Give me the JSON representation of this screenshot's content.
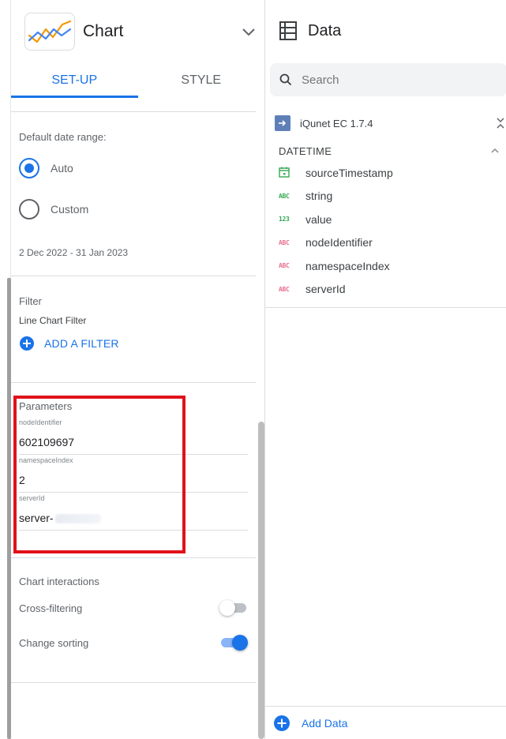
{
  "chart_panel": {
    "title": "Chart",
    "tabs": [
      {
        "label": "SET-UP",
        "active": true
      },
      {
        "label": "STYLE",
        "active": false
      }
    ]
  },
  "date_range": {
    "label": "Default date range:",
    "options": [
      {
        "label": "Auto",
        "selected": true
      },
      {
        "label": "Custom",
        "selected": false
      }
    ],
    "range_text": "2 Dec 2022 - 31 Jan 2023"
  },
  "filter": {
    "heading": "Filter",
    "subheading": "Line Chart Filter",
    "add_label": "ADD A FILTER"
  },
  "parameters": {
    "heading": "Parameters",
    "fields": [
      {
        "caption": "nodeIdentifier",
        "value": "602109697"
      },
      {
        "caption": "namespaceIndex",
        "value": "2"
      },
      {
        "caption": "serverId",
        "value": "server-"
      }
    ]
  },
  "interactions": {
    "heading": "Chart interactions",
    "toggles": [
      {
        "label": "Cross-filtering",
        "on": false
      },
      {
        "label": "Change sorting",
        "on": true
      }
    ]
  },
  "data_panel": {
    "title": "Data",
    "search_placeholder": "Search",
    "source": "iQunet EC 1.7.4",
    "group": "DATETIME",
    "fields": [
      {
        "type": "date",
        "type_label": "",
        "label": "sourceTimestamp"
      },
      {
        "type": "text",
        "type_label": "ABC",
        "label": "string"
      },
      {
        "type": "number",
        "type_label": "123",
        "label": "value"
      },
      {
        "type": "text-pink",
        "type_label": "ABC",
        "label": "nodeIdentifier"
      },
      {
        "type": "text-pink",
        "type_label": "ABC",
        "label": "namespaceIndex"
      },
      {
        "type": "text-pink",
        "type_label": "ABC",
        "label": "serverId"
      }
    ],
    "add_data_label": "Add Data"
  },
  "colors": {
    "accent": "#1a73e8",
    "highlight_box": "#e0121a",
    "text_type_green": "#34a853",
    "text_type_pink": "#e66f8f"
  }
}
